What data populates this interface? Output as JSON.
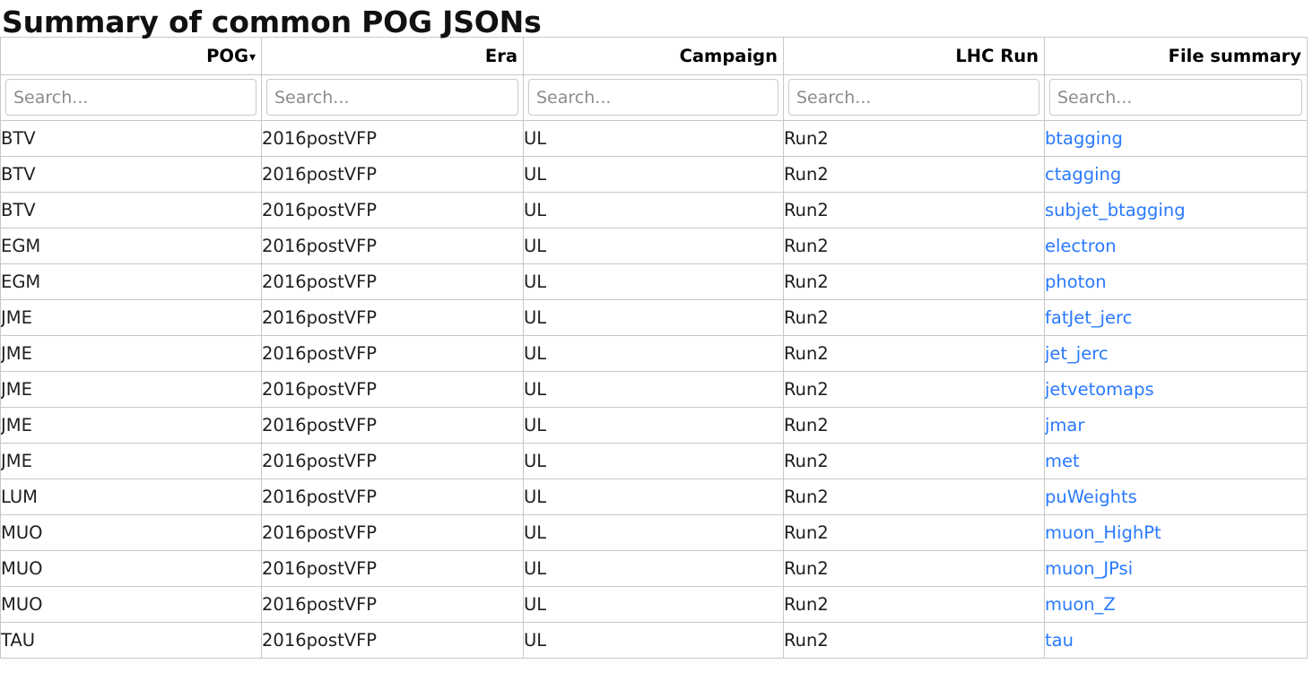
{
  "header": {
    "title": "Summary of common POG JSONs"
  },
  "table": {
    "columns": [
      {
        "key": "pog",
        "label": "POG",
        "sorted": true,
        "sort_icon": "caret-down-icon",
        "sort_glyph": "▾"
      },
      {
        "key": "era",
        "label": "Era",
        "sorted": false
      },
      {
        "key": "campaign",
        "label": "Campaign",
        "sorted": false
      },
      {
        "key": "lhc_run",
        "label": "LHC Run",
        "sorted": false
      },
      {
        "key": "file_summary",
        "label": "File summary",
        "sorted": false
      }
    ],
    "filters": [
      {
        "key": "pog",
        "placeholder": "Search...",
        "value": ""
      },
      {
        "key": "era",
        "placeholder": "Search...",
        "value": ""
      },
      {
        "key": "campaign",
        "placeholder": "Search...",
        "value": ""
      },
      {
        "key": "lhc_run",
        "placeholder": "Search...",
        "value": ""
      },
      {
        "key": "file_summary",
        "placeholder": "Search...",
        "value": ""
      }
    ],
    "link_color": "#2979ff",
    "rows": [
      {
        "pog": "BTV",
        "era": "2016postVFP",
        "campaign": "UL",
        "lhc_run": "Run2",
        "file_summary": "btagging"
      },
      {
        "pog": "BTV",
        "era": "2016postVFP",
        "campaign": "UL",
        "lhc_run": "Run2",
        "file_summary": "ctagging"
      },
      {
        "pog": "BTV",
        "era": "2016postVFP",
        "campaign": "UL",
        "lhc_run": "Run2",
        "file_summary": "subjet_btagging"
      },
      {
        "pog": "EGM",
        "era": "2016postVFP",
        "campaign": "UL",
        "lhc_run": "Run2",
        "file_summary": "electron"
      },
      {
        "pog": "EGM",
        "era": "2016postVFP",
        "campaign": "UL",
        "lhc_run": "Run2",
        "file_summary": "photon"
      },
      {
        "pog": "JME",
        "era": "2016postVFP",
        "campaign": "UL",
        "lhc_run": "Run2",
        "file_summary": "fatJet_jerc"
      },
      {
        "pog": "JME",
        "era": "2016postVFP",
        "campaign": "UL",
        "lhc_run": "Run2",
        "file_summary": "jet_jerc"
      },
      {
        "pog": "JME",
        "era": "2016postVFP",
        "campaign": "UL",
        "lhc_run": "Run2",
        "file_summary": "jetvetomaps"
      },
      {
        "pog": "JME",
        "era": "2016postVFP",
        "campaign": "UL",
        "lhc_run": "Run2",
        "file_summary": "jmar"
      },
      {
        "pog": "JME",
        "era": "2016postVFP",
        "campaign": "UL",
        "lhc_run": "Run2",
        "file_summary": "met"
      },
      {
        "pog": "LUM",
        "era": "2016postVFP",
        "campaign": "UL",
        "lhc_run": "Run2",
        "file_summary": "puWeights"
      },
      {
        "pog": "MUO",
        "era": "2016postVFP",
        "campaign": "UL",
        "lhc_run": "Run2",
        "file_summary": "muon_HighPt"
      },
      {
        "pog": "MUO",
        "era": "2016postVFP",
        "campaign": "UL",
        "lhc_run": "Run2",
        "file_summary": "muon_JPsi"
      },
      {
        "pog": "MUO",
        "era": "2016postVFP",
        "campaign": "UL",
        "lhc_run": "Run2",
        "file_summary": "muon_Z"
      },
      {
        "pog": "TAU",
        "era": "2016postVFP",
        "campaign": "UL",
        "lhc_run": "Run2",
        "file_summary": "tau"
      }
    ]
  }
}
